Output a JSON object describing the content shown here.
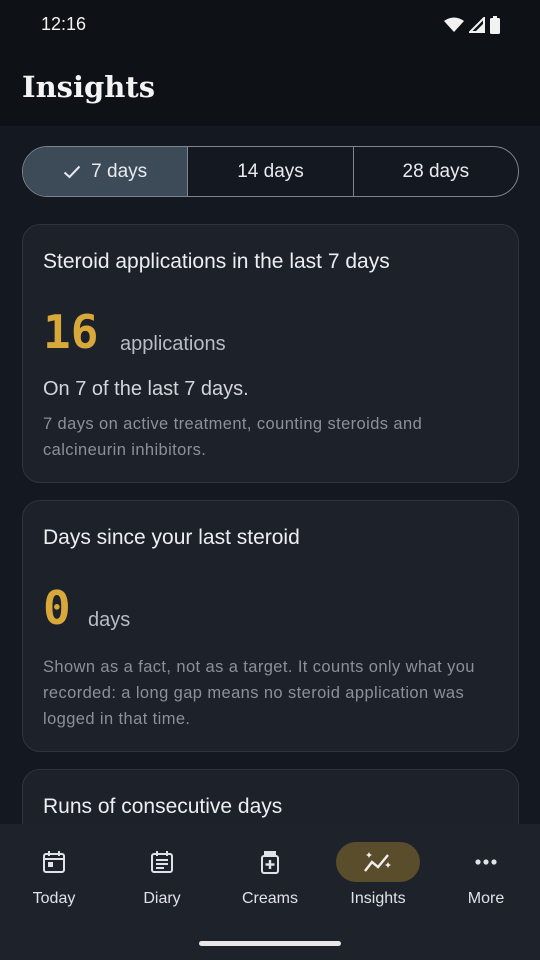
{
  "status_bar": {
    "time": "12:16"
  },
  "header": {
    "title": "Insights"
  },
  "range_selector": {
    "options": [
      {
        "label": "7 days",
        "selected": true
      },
      {
        "label": "14 days",
        "selected": false
      },
      {
        "label": "28 days",
        "selected": false
      }
    ]
  },
  "cards": {
    "applications": {
      "title": "Steroid applications in the last 7 days",
      "value": "16",
      "unit": "applications",
      "subtitle": "On 7 of the last 7 days.",
      "description": "7 days on active treatment, counting steroids and calcineurin inhibitors."
    },
    "days_since": {
      "title": "Days since your last steroid",
      "value": "0",
      "unit": "days",
      "description": "Shown as a fact, not as a target. It counts only what you recorded: a long gap means no steroid application was logged in that time."
    },
    "runs": {
      "title": "Runs of consecutive days"
    }
  },
  "bottom_nav": {
    "items": [
      {
        "label": "Today",
        "icon": "calendar-icon",
        "active": false
      },
      {
        "label": "Diary",
        "icon": "diary-icon",
        "active": false
      },
      {
        "label": "Creams",
        "icon": "cream-jar-icon",
        "active": false
      },
      {
        "label": "Insights",
        "icon": "insights-chart-icon",
        "active": true
      },
      {
        "label": "More",
        "icon": "more-dots-icon",
        "active": false
      }
    ]
  },
  "colors": {
    "accent_number": "#d9a83a",
    "selected_segment": "#3d4b58",
    "active_nav_pill": "#5a4d2c",
    "background": "#141820",
    "card": "#1c212a"
  }
}
